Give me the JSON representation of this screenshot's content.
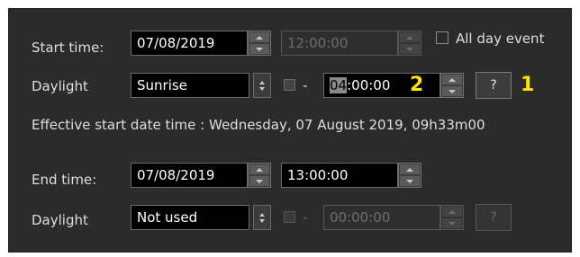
{
  "start": {
    "label": "Start time:",
    "date": "07/08/2019",
    "time": "12:00:00",
    "all_day_label": "All day event"
  },
  "daylight1": {
    "label": "Daylight",
    "value": "Sunrise",
    "dash": "-",
    "offset_selected": "04",
    "offset_rest": ":00:00",
    "help_label": "?",
    "marker_2": "2",
    "marker_1": "1"
  },
  "effective": {
    "text": "Effective start date time : Wednesday, 07 August 2019, 09h33m00"
  },
  "end": {
    "label": "End time:",
    "date": "07/08/2019",
    "time": "13:00:00"
  },
  "daylight2": {
    "label": "Daylight",
    "value": "Not used",
    "dash": "-",
    "offset": "00:00:00",
    "help_label": "?"
  },
  "colors": {
    "panel_bg": "#2b2b2b",
    "field_bg": "#000000",
    "marker": "#ffe400"
  }
}
